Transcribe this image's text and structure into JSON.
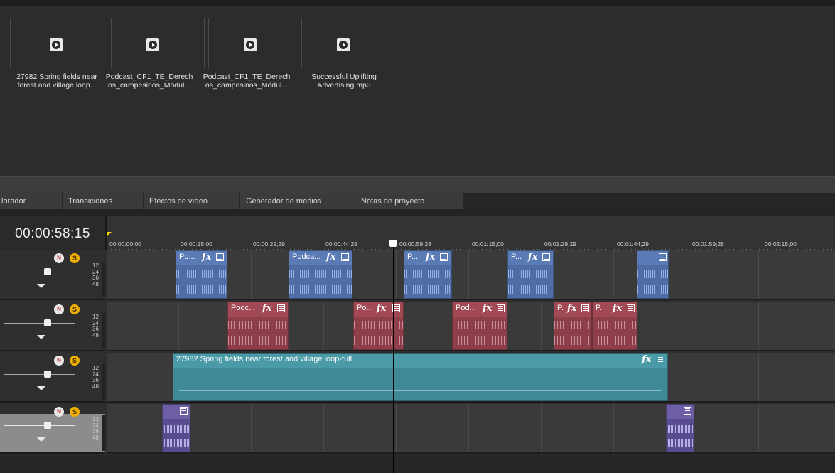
{
  "media_bin": {
    "items": [
      {
        "label_line1": "27982 Spring fields near",
        "label_line2": "forest and village loop..."
      },
      {
        "label_line1": "Podcast_CF1_TE_Derech",
        "label_line2": "os_campesinos_Módul..."
      },
      {
        "label_line1": "Podcast_CF1_TE_Derech",
        "label_line2": "os_campesinos_Módul..."
      },
      {
        "label_line1": "Successful Uplifting",
        "label_line2": "Advertising.mp3"
      }
    ]
  },
  "tabs": [
    "lorador",
    "Transiciones",
    "Efectos de vídeo",
    "Generador de medios",
    "Notas de proyecto"
  ],
  "timeline": {
    "timecode": "00:00:58;15",
    "ruler_labels": [
      "00:00:00;00",
      "00:00:15;00",
      "00:00:29;29",
      "00:00:44;29",
      "00:00:59;28",
      "00:01:15;00",
      "00:01:29;29",
      "00:01:44;29",
      "00:01:59;28",
      "00:02:15;00"
    ]
  },
  "tracks": [
    {
      "mute": "N",
      "solo": "S",
      "scale": [
        "12",
        "24",
        "36",
        "48"
      ],
      "clips": [
        {
          "title": "Po...",
          "fx": "fx"
        },
        {
          "title": "Podca...",
          "fx": "fx"
        },
        {
          "title": "P...",
          "fx": "fx"
        },
        {
          "title": "P...",
          "fx": "fx"
        },
        {
          "title": "",
          "fx": ""
        }
      ]
    },
    {
      "mute": "N",
      "solo": "S",
      "scale": [
        "12",
        "24",
        "36",
        "48"
      ],
      "clips": [
        {
          "title": "Podc...",
          "fx": "fx"
        },
        {
          "title": "Po...",
          "fx": "fx"
        },
        {
          "title": "Pod...",
          "fx": "fx"
        },
        {
          "title": "P.",
          "fx": "fx"
        },
        {
          "title": "P...",
          "fx": "fx"
        }
      ]
    },
    {
      "mute": "N",
      "solo": "S",
      "scale": [
        "12",
        "24",
        "36",
        "48"
      ],
      "clips": [
        {
          "title": "27982 Spring fields near forest and village loop-full",
          "fx": "fx"
        }
      ]
    },
    {
      "mute": "N",
      "solo": "S",
      "scale": [
        "12",
        "24",
        "36",
        "48"
      ],
      "clips": [
        {
          "title": "",
          "fx": ""
        },
        {
          "title": "",
          "fx": ""
        }
      ]
    }
  ],
  "colors": {
    "track1": "#5b7bb6",
    "track2": "#a14a55",
    "track3": "#4b9aa8",
    "track4": "#6e5ea6"
  }
}
